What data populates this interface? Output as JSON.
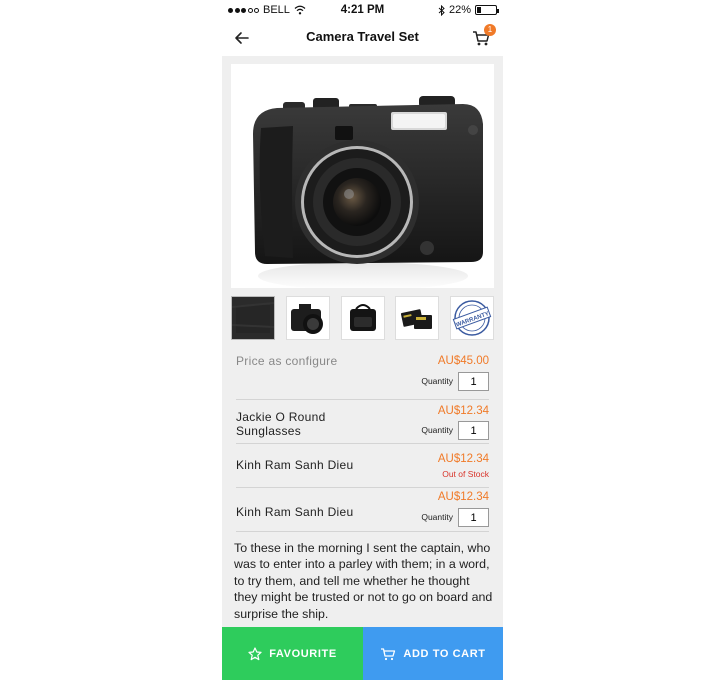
{
  "status_bar": {
    "carrier": "BELL",
    "time": "4:21 PM",
    "battery": "22%",
    "battery_level": 0.22
  },
  "nav": {
    "title": "Camera Travel Set",
    "cart_count": "1"
  },
  "gallery": {
    "thumbnails": [
      "texture-swatch",
      "dslr-camera",
      "camera-bag",
      "memory-cards",
      "warranty-badge"
    ],
    "selected_index": 0,
    "warranty_stamp_text": "WARRANTY"
  },
  "main_product": {
    "label": "Price as configure",
    "price": "AU$45.00",
    "quantity_label": "Quantity",
    "quantity": "1"
  },
  "items": [
    {
      "name": "Jackie O Round Sunglasses",
      "price": "AU$12.34",
      "quantity_label": "Quantity",
      "quantity": "1"
    },
    {
      "name": "Kinh Ram Sanh Dieu",
      "price": "AU$12.34",
      "status": "Out of Stock"
    },
    {
      "name": "Kinh Ram Sanh Dieu",
      "price": "AU$12.34",
      "quantity_label": "Quantity",
      "quantity": "1"
    }
  ],
  "description": "To these in the morning I sent the captain, who was to enter into a parley with them; in a word, to try them, and tell me whether he thought they might be trusted or not to go on board and surprise the ship.",
  "actions": {
    "favourite": "FAVOURITE",
    "add_to_cart": "ADD TO CART"
  },
  "colors": {
    "accent_orange": "#f07a28",
    "favourite_green": "#2ecc5c",
    "cart_blue": "#3f9bf0",
    "out_of_stock_red": "#d8342a"
  }
}
